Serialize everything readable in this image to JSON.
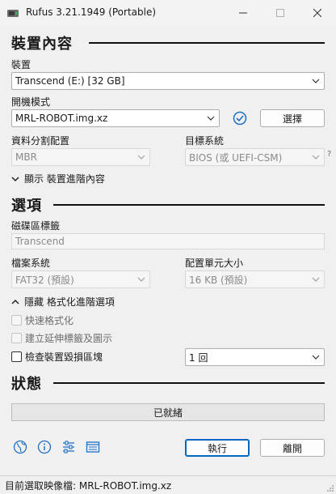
{
  "window": {
    "title": "Rufus 3.21.1949 (Portable)",
    "accent_color": "#0067c0"
  },
  "drive_properties": {
    "heading": "裝置內容",
    "device": {
      "label": "裝置",
      "value": "Transcend (E:) [32 GB]"
    },
    "boot_selection": {
      "label": "開機模式",
      "value": "MRL-ROBOT.img.xz",
      "select_button": "選擇"
    },
    "partition_scheme": {
      "label": "資料分割配置",
      "value": "MBR"
    },
    "target_system": {
      "label": "目標系統",
      "value": "BIOS (或 UEFI-CSM)",
      "help": "?"
    },
    "advanced_toggle": "顯示 裝置進階內容"
  },
  "format_options": {
    "heading": "選項",
    "volume_label": {
      "label": "磁碟區標籤",
      "value": "Transcend"
    },
    "file_system": {
      "label": "檔案系統",
      "value": "FAT32 (預設)"
    },
    "cluster_size": {
      "label": "配置單元大小",
      "value": "16 KB (預設)"
    },
    "advanced_toggle": "隱藏 格式化進階選項",
    "quick_format": {
      "label": "快速格式化",
      "checked": false,
      "enabled": false
    },
    "extended_label": {
      "label": "建立延伸標籤及圖示",
      "checked": false,
      "enabled": false
    },
    "bad_blocks": {
      "label": "檢查裝置毀損區塊",
      "checked": false,
      "enabled": true,
      "passes": "1 回"
    }
  },
  "status": {
    "heading": "狀態",
    "progress_text": "已就緒",
    "progress_fraction": 0
  },
  "actions": {
    "start": "執行",
    "close": "離開"
  },
  "toolbar_icons": [
    "globe-icon",
    "info-icon",
    "settings-icon",
    "log-icon"
  ],
  "statusbar": {
    "text": "目前選取映像檔: MRL-ROBOT.img.xz"
  }
}
